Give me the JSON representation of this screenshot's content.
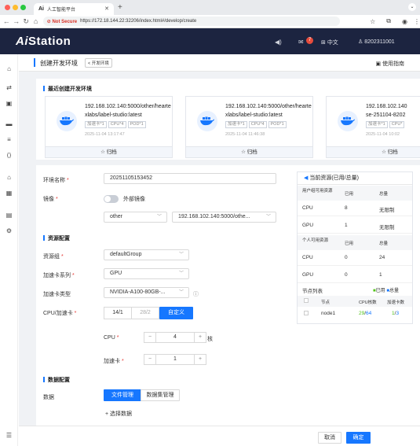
{
  "browser": {
    "tab_title": "人工智能平台",
    "tab_logo": "Ai",
    "security": "Not Secure",
    "url": "https://172.18.144.22:32206/index.html#/develop/create"
  },
  "header": {
    "brand_prefix": "Ai",
    "brand_suffix": "Station",
    "notif_count": "7",
    "language": "中文",
    "user": "8202311001"
  },
  "page": {
    "title": "创建开发环境",
    "back_label": "< 开发环境",
    "guide": "使用指南"
  },
  "recent": {
    "title": "最近创建开发环境",
    "archive_label": "☆ 归档",
    "cards": [
      {
        "name_line1": "192.168.102.140:5000/other/hearte",
        "name_line2": "xlabs/label-studio:latest",
        "tags": [
          "加速卡*1",
          "CPU*4",
          "POD*1"
        ],
        "time": "2025-11-04 13:17:47"
      },
      {
        "name_line1": "192.168.102.140:5000/other/hearte",
        "name_line2": "xlabs/label-studio:latest",
        "tags": [
          "加速卡*1",
          "CPU*4",
          "POD*1"
        ],
        "time": "2025-11-04 11:46:38"
      },
      {
        "name_line1": "192.168.102.140",
        "name_line2": "se-251104-8202",
        "tags": [
          "加速卡*1",
          "CPU*"
        ],
        "time": "2025-11-04 10:02"
      }
    ]
  },
  "form": {
    "env_name_label": "环境名称",
    "env_name_value": "20251105153452",
    "image_label": "镜像",
    "external_image_label": "外部镜像",
    "image_category": "other",
    "image_value": "192.168.102.140:5000/othe...",
    "resource_section": "资源配置",
    "resource_group_label": "资源组",
    "resource_group_value": "defaultGroup",
    "acc_series_label": "加速卡系列",
    "acc_series_value": "GPU",
    "acc_type_label": "加速卡类型",
    "acc_type_value": "NVIDIA-A100-80GB-...",
    "ratio_label": "CPU/加速卡",
    "ratio_options": [
      "14/1",
      "28/2",
      "自定义"
    ],
    "cpu_label": "CPU",
    "cpu_value": "4",
    "cpu_unit": "核",
    "acc_label": "加速卡",
    "acc_value": "1",
    "data_section": "数据配置",
    "data_label": "数据",
    "data_tabs": [
      "文件管理",
      "数据集管理"
    ],
    "add_data": "+ 选择数据"
  },
  "resources": {
    "title": "当前资源(已用/总量)",
    "user_header": [
      "用户组可用资源",
      "已用",
      "总量"
    ],
    "user_rows": [
      [
        "CPU",
        "8",
        "无限制"
      ],
      [
        "GPU",
        "1",
        "无限制"
      ]
    ],
    "personal_header": [
      "个人可用资源",
      "已用",
      "总量"
    ],
    "personal_rows": [
      [
        "CPU",
        "0",
        "24"
      ],
      [
        "GPU",
        "0",
        "1"
      ]
    ],
    "node_list": "节点列表",
    "legend_used": "已用",
    "legend_total": "总量",
    "node_header": [
      "节点",
      "CPU核数",
      "加速卡数"
    ],
    "node_rows": [
      {
        "name": "node1",
        "cpu_used": "29",
        "cpu_total": "64",
        "acc_used": "1",
        "acc_total": "3"
      }
    ]
  },
  "footer": {
    "cancel": "取消",
    "confirm": "确定"
  },
  "colors": {
    "accent": "#1677ff",
    "header_bg": "#1c2440",
    "used": "#52c41a",
    "required": "#e53935"
  }
}
